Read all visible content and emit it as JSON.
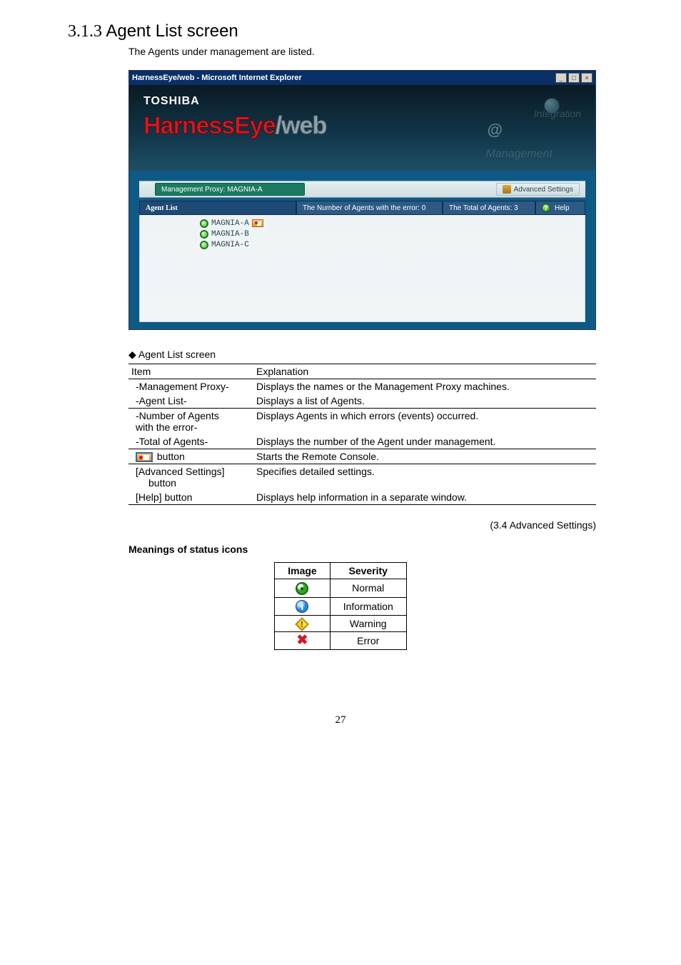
{
  "section_number": "3.1.3",
  "section_title": "Agent List screen",
  "subtitle": "The Agents under management are listed.",
  "ie_title": "HarnessEye/web - Microsoft Internet Explorer",
  "brand": "TOSHIBA",
  "logo_part1": "HarnessEye",
  "logo_part2": "/web",
  "hero_deco_at": "@",
  "hero_deco_faded1": "Integration",
  "hero_deco_faded2": "Management",
  "proxy_label": "Management Proxy: MAGNIA-A",
  "advanced_settings_label": "Advanced Settings",
  "header": {
    "list": "Agent List",
    "err": "The Number of Agents with the error: 0",
    "total": "The Total of Agents: 3",
    "help": "Help"
  },
  "agents": [
    {
      "name": "MAGNIA-A",
      "remote_console": true
    },
    {
      "name": "MAGNIA-B",
      "remote_console": false
    },
    {
      "name": "MAGNIA-C",
      "remote_console": false
    }
  ],
  "table_caption": "Agent List screen",
  "table_header": {
    "item": "Item",
    "exp": "Explanation"
  },
  "table_rows": {
    "r1i": "-Management Proxy-",
    "r1e": "Displays the names or the Management Proxy machines.",
    "r2i": "-Agent List-",
    "r2e": "Displays a list of Agents.",
    "r3i1": "-Number of Agents",
    "r3i2": "with the error-",
    "r3e": "Displays Agents in which errors (events) occurred.",
    "r4i": "-Total of Agents-",
    "r4e": "Displays the number of the Agent under management.",
    "r5i": " button",
    "r5e": "Starts the Remote Console.",
    "r6i1": "[Advanced Settings]",
    "r6i2": "button",
    "r6e": "Specifies detailed settings.",
    "r7i": "[Help] button",
    "r7e": "Displays help information in a separate window."
  },
  "other_ref": "(3.4  Advanced  Settings)",
  "subhead": "Meanings of status icons",
  "sev_header": {
    "image": "Image",
    "severity": "Severity"
  },
  "sev": {
    "normal": "Normal",
    "info": "Information",
    "warn": "Warning",
    "error": "Error"
  },
  "page_number": "27"
}
